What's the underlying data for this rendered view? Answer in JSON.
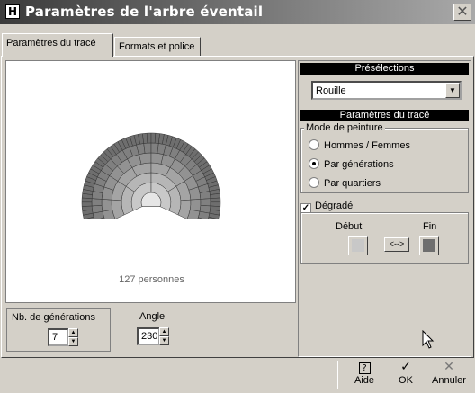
{
  "window": {
    "title": "Paramètres de l'arbre éventail",
    "icon": "H"
  },
  "tabs": [
    {
      "label": "Paramètres du tracé",
      "active": true
    },
    {
      "label": "Formats et police",
      "active": false
    }
  ],
  "preview": {
    "persons_count": "127",
    "persons_label": "personnes"
  },
  "presets": {
    "header": "Présélections",
    "selected": "Rouille"
  },
  "trace": {
    "header": "Paramètres du tracé",
    "paint_mode_label": "Mode de peinture",
    "options": [
      {
        "label": "Hommes / Femmes",
        "selected": false
      },
      {
        "label": "Par générations",
        "selected": true
      },
      {
        "label": "Par quartiers",
        "selected": false
      }
    ],
    "gradient_label": "Dégradé",
    "gradient_checked": true,
    "start_label": "Début",
    "end_label": "Fin",
    "swap_label": "<-->",
    "start_color": "#c8c8c8",
    "end_color": "#6e6e6e"
  },
  "generations": {
    "label": "Nb. de générations",
    "value": "7"
  },
  "angle": {
    "label": "Angle",
    "value": "230"
  },
  "statusbar": {
    "help_label": "Aide",
    "ok_label": "OK",
    "cancel_label": "Annuler"
  }
}
